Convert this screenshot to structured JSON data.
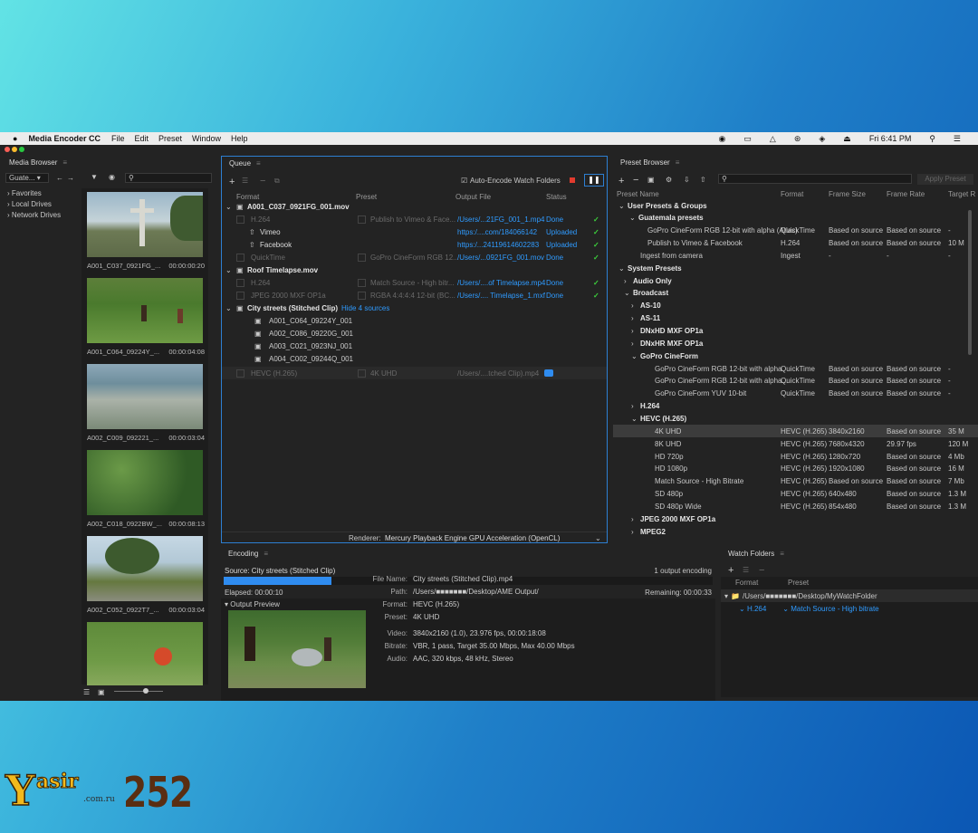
{
  "menubar": {
    "app": "Media Encoder CC",
    "menus": [
      "File",
      "Edit",
      "Preset",
      "Window",
      "Help"
    ],
    "clock": "Fri 6:41 PM"
  },
  "media_browser": {
    "title": "Media Browser",
    "location": "Guate...",
    "tree": [
      "Favorites",
      "Local Drives",
      "Network Drives"
    ],
    "clips": [
      {
        "name": "A001_C037_0921FG_...",
        "dur": "00:00:00:20"
      },
      {
        "name": "A001_C064_09224Y_...",
        "dur": "00:00:04:08"
      },
      {
        "name": "A002_C009_092221_...",
        "dur": "00:00:03:04"
      },
      {
        "name": "A002_C018_0922BW_...",
        "dur": "00:00:08:13"
      },
      {
        "name": "A002_C052_0922T7_...",
        "dur": "00:00:03:04"
      }
    ]
  },
  "queue": {
    "title": "Queue",
    "auto_encode": "Auto-Encode Watch Folders",
    "columns": {
      "format": "Format",
      "preset": "Preset",
      "output": "Output File",
      "status": "Status"
    },
    "items": [
      {
        "name": "A001_C037_0921FG_001.mov"
      },
      {
        "fmt": "H.264",
        "preset": "Publish to Vimeo & Face...",
        "out": "/Users/...21FG_001_1.mp4",
        "status": "Done"
      },
      {
        "fmt": "Vimeo",
        "out": "https:/....com/184066142",
        "status": "Uploaded"
      },
      {
        "fmt": "Facebook",
        "out": "https:/...24119614602283",
        "status": "Uploaded"
      },
      {
        "fmt": "QuickTime",
        "preset": "GoPro CineForm RGB 12...",
        "out": "/Users/...0921FG_001.mov",
        "status": "Done"
      },
      {
        "name": "Roof Timelapse.mov"
      },
      {
        "fmt": "H.264",
        "preset": "Match Source - High bitr...",
        "out": "/Users/....of Timelapse.mp4",
        "status": "Done"
      },
      {
        "fmt": "JPEG 2000 MXF OP1a",
        "preset": "RGBA 4:4:4:4 12-bit (BC...",
        "out": "/Users/.... Timelapse_1.mxf",
        "status": "Done"
      },
      {
        "name": "City streets (Stitched Clip)",
        "link": "Hide 4 sources"
      },
      {
        "src": "A001_C064_09224Y_001"
      },
      {
        "src": "A002_C086_09220G_001"
      },
      {
        "src": "A003_C021_0923NJ_001"
      },
      {
        "src": "A004_C002_09244Q_001"
      },
      {
        "fmt": "HEVC (H.265)",
        "preset": "4K UHD",
        "out": "/Users/....tched Clip).mp4"
      }
    ],
    "renderer_label": "Renderer:",
    "renderer": "Mercury Playback Engine GPU Acceleration (OpenCL)"
  },
  "preset_browser": {
    "title": "Preset Browser",
    "apply": "Apply Preset",
    "columns": {
      "name": "Preset Name",
      "format": "Format",
      "size": "Frame Size",
      "rate": "Frame Rate",
      "target": "Target R"
    },
    "rows": [
      {
        "name": "User Presets & Groups"
      },
      {
        "name": "Guatemala presets"
      },
      {
        "name": "GoPro CineForm RGB 12-bit with alpha (Atlas)",
        "format": "QuickTime",
        "size": "Based on source",
        "rate": "Based on source",
        "target": "-"
      },
      {
        "name": "Publish to Vimeo & Facebook",
        "format": "H.264",
        "size": "Based on source",
        "rate": "Based on source",
        "target": "10 M"
      },
      {
        "name": "Ingest from camera",
        "format": "Ingest",
        "size": "-",
        "rate": "-",
        "target": "-"
      },
      {
        "name": "System Presets"
      },
      {
        "name": "Audio Only"
      },
      {
        "name": "Broadcast"
      },
      {
        "name": "AS-10"
      },
      {
        "name": "AS-11"
      },
      {
        "name": "DNxHD MXF OP1a"
      },
      {
        "name": "DNxHR MXF OP1a"
      },
      {
        "name": "GoPro CineForm"
      },
      {
        "name": "GoPro CineForm RGB 12-bit with alpha",
        "format": "QuickTime",
        "size": "Based on source",
        "rate": "Based on source",
        "target": "-"
      },
      {
        "name": "GoPro CineForm RGB 12-bit with alpha...",
        "format": "QuickTime",
        "size": "Based on source",
        "rate": "Based on source",
        "target": "-"
      },
      {
        "name": "GoPro CineForm YUV 10-bit",
        "format": "QuickTime",
        "size": "Based on source",
        "rate": "Based on source",
        "target": "-"
      },
      {
        "name": "H.264"
      },
      {
        "name": "HEVC (H.265)"
      },
      {
        "name": "4K UHD",
        "format": "HEVC (H.265)",
        "size": "3840x2160",
        "rate": "Based on source",
        "target": "35 M"
      },
      {
        "name": "8K UHD",
        "format": "HEVC (H.265)",
        "size": "7680x4320",
        "rate": "29.97 fps",
        "target": "120 M"
      },
      {
        "name": "HD 720p",
        "format": "HEVC (H.265)",
        "size": "1280x720",
        "rate": "Based on source",
        "target": "4 Mb"
      },
      {
        "name": "HD 1080p",
        "format": "HEVC (H.265)",
        "size": "1920x1080",
        "rate": "Based on source",
        "target": "16 M"
      },
      {
        "name": "Match Source - High Bitrate",
        "format": "HEVC (H.265)",
        "size": "Based on source",
        "rate": "Based on source",
        "target": "7 Mb"
      },
      {
        "name": "SD 480p",
        "format": "HEVC (H.265)",
        "size": "640x480",
        "rate": "Based on source",
        "target": "1.3 M"
      },
      {
        "name": "SD 480p Wide",
        "format": "HEVC (H.265)",
        "size": "854x480",
        "rate": "Based on source",
        "target": "1.3 M"
      },
      {
        "name": "JPEG 2000 MXF OP1a"
      },
      {
        "name": "MPEG2"
      }
    ]
  },
  "encoding": {
    "title": "Encoding",
    "source": "Source: City streets (Stitched Clip)",
    "count": "1 output encoding",
    "progress": 0.22,
    "elapsed": "Elapsed: 00:00:10",
    "remaining": "Remaining: 00:00:33",
    "preview": "Output Preview",
    "info": [
      {
        "k": "File Name:",
        "v": "City streets (Stitched Clip).mp4"
      },
      {
        "k": "Path:",
        "v": "/Users/■■■■■■■/Desktop/AME Output/"
      },
      {
        "k": "Format:",
        "v": "HEVC (H.265)"
      },
      {
        "k": "Preset:",
        "v": "4K UHD"
      },
      {
        "k": "Video:",
        "v": "3840x2160 (1.0), 23.976 fps, 00:00:18:08"
      },
      {
        "k": "Bitrate:",
        "v": "VBR, 1 pass, Target 35.00 Mbps, Max 40.00 Mbps"
      },
      {
        "k": "Audio:",
        "v": "AAC, 320 kbps, 48 kHz, Stereo"
      }
    ]
  },
  "watch": {
    "title": "Watch Folders",
    "format_col": "Format",
    "preset_col": "Preset",
    "folder": "/Users/■■■■■■■/Desktop/MyWatchFolder",
    "fmt": "H.264",
    "preset": "Match Source - High bitrate"
  },
  "watermark": {
    "brand": "Yasir252",
    "sub": ".com.ru"
  }
}
